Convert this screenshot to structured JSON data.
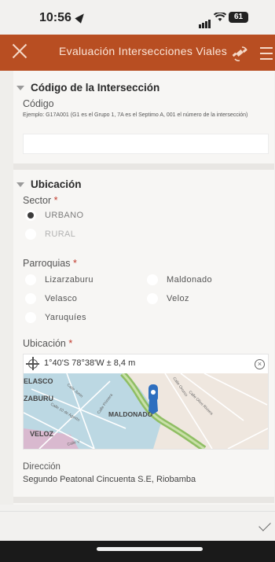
{
  "status_bar": {
    "time": "10:56",
    "battery": "61"
  },
  "app_bar": {
    "title": "Evaluación Intersecciones Viales"
  },
  "section_code": {
    "title": "Código de la Intersección",
    "field_label": "Código",
    "hint": "Ejemplo: G17A001 (G1 es el Grupo 1, 7A es el Septimo A, 001 el número de la intersección)",
    "value": ""
  },
  "section_location": {
    "title": "Ubicación",
    "sector_label": "Sector",
    "required_mark": "*",
    "sector_options": [
      {
        "label": "URBANO",
        "selected": true
      },
      {
        "label": "RURAL",
        "selected": false
      }
    ],
    "parroquias_label": "Parroquias",
    "parroquias_options": [
      {
        "label": "Lizarzaburu",
        "selected": false
      },
      {
        "label": "Maldonado",
        "selected": false
      },
      {
        "label": "Velasco",
        "selected": false
      },
      {
        "label": "Veloz",
        "selected": false
      },
      {
        "label": "Yaruquíes",
        "selected": false
      }
    ],
    "ubicacion_label": "Ubicación",
    "coordinates": "1°40'S 78°38'W ± 8,4 m",
    "map_labels": {
      "velasco": "ELASCO",
      "lizarzaburu": "ZABURU",
      "maldonado": "MALDONADO",
      "veloz": "VELOZ",
      "calle_junin": "Calle Junin",
      "calle_10_agosto": "Calle 10 de Agosto",
      "calle_primera": "Calle Primera",
      "calle_orozco": "Calle Orozco",
      "calle_olivo": "Calle Olivo Riviera",
      "calle_v": "Calle V"
    },
    "direccion_label": "Dirección",
    "direccion_value": "Segundo Peatonal Cincuenta S.E, Riobamba"
  },
  "colors": {
    "app_bar": "#b84e22",
    "pin": "#2e6fbf",
    "road": "#6aa84f"
  }
}
